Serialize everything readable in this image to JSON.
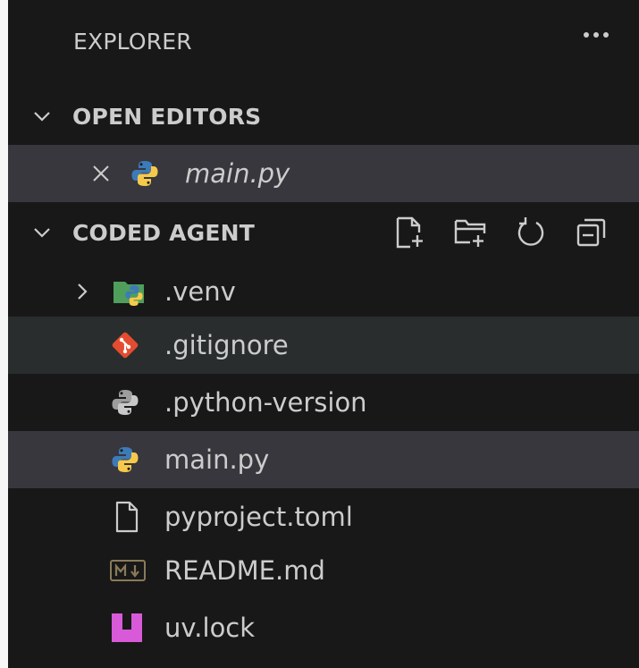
{
  "explorer": {
    "title": "EXPLORER"
  },
  "open_editors": {
    "label": "OPEN EDITORS",
    "items": [
      {
        "name": "main.py",
        "icon": "python-icon"
      }
    ]
  },
  "workspace": {
    "label": "CODED AGENT",
    "actions": [
      "new-file-icon",
      "new-folder-icon",
      "refresh-icon",
      "collapse-all-icon"
    ],
    "items": [
      {
        "name": ".venv",
        "icon": "folder-python-icon",
        "type": "folder",
        "collapsed": true
      },
      {
        "name": ".gitignore",
        "icon": "git-icon"
      },
      {
        "name": ".python-version",
        "icon": "python-gray-icon"
      },
      {
        "name": "main.py",
        "icon": "python-icon",
        "selected": true
      },
      {
        "name": "pyproject.toml",
        "icon": "file-icon"
      },
      {
        "name": "README.md",
        "icon": "markdown-icon"
      },
      {
        "name": "uv.lock",
        "icon": "uv-lock-icon"
      }
    ]
  },
  "colors": {
    "background": "#181818",
    "selected_row": "#37373d",
    "hover_row": "#2a2d2e",
    "text": "#cccccc"
  }
}
